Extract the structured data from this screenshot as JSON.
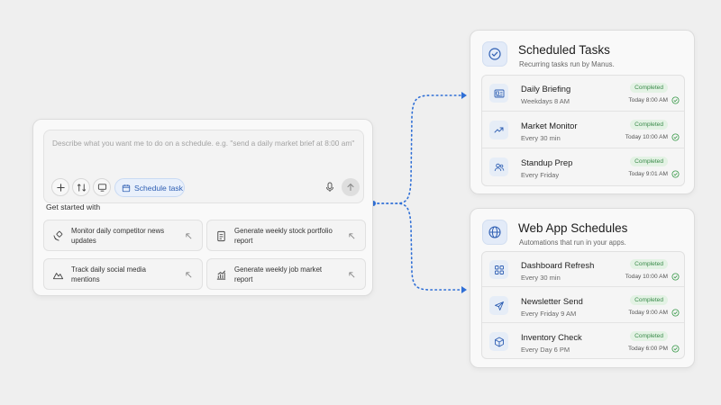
{
  "composer": {
    "placeholder": "Describe what you want me to do on a schedule. e.g. \"send a daily market brief at 8:00 am\"",
    "schedule_label": "Schedule task",
    "get_started": "Get started with",
    "suggestions": [
      {
        "text": "Monitor daily competitor news updates",
        "icon": "satellite-icon"
      },
      {
        "text": "Generate weekly stock portfolio report",
        "icon": "document-icon"
      },
      {
        "text": "Track daily social media mentions",
        "icon": "mountain-chart-icon"
      },
      {
        "text": "Generate weekly job market report",
        "icon": "bar-chart-icon"
      }
    ]
  },
  "scheduled": {
    "title": "Scheduled Tasks",
    "subtitle": "Recurring tasks run by Manus.",
    "icon": "check-circle-icon",
    "tasks": [
      {
        "name": "Daily Briefing",
        "schedule": "Weekdays 8 AM",
        "status": "Completed",
        "time": "Today 8:00 AM",
        "icon": "news-icon"
      },
      {
        "name": "Market Monitor",
        "schedule": "Every 30 min",
        "status": "Completed",
        "time": "Today 10:00 AM",
        "icon": "trend-icon"
      },
      {
        "name": "Standup Prep",
        "schedule": "Every Friday",
        "status": "Completed",
        "time": "Today 9:01 AM",
        "icon": "users-icon"
      }
    ]
  },
  "webapp": {
    "title": "Web App Schedules",
    "subtitle": "Automations that run in your apps.",
    "icon": "globe-icon",
    "tasks": [
      {
        "name": "Dashboard Refresh",
        "schedule": "Every 30 min",
        "status": "Completed",
        "time": "Today 10:00 AM",
        "icon": "grid-icon"
      },
      {
        "name": "Newsletter Send",
        "schedule": "Every Friday 9 AM",
        "status": "Completed",
        "time": "Today 9:00 AM",
        "icon": "send-icon"
      },
      {
        "name": "Inventory Check",
        "schedule": "Every Day 6 PM",
        "status": "Completed",
        "time": "Today 6:00 PM",
        "icon": "box-icon"
      }
    ]
  },
  "colors": {
    "accent": "#2f6fd6",
    "completed_text": "#3a8a4a",
    "completed_bg": "#e3f2e4"
  }
}
